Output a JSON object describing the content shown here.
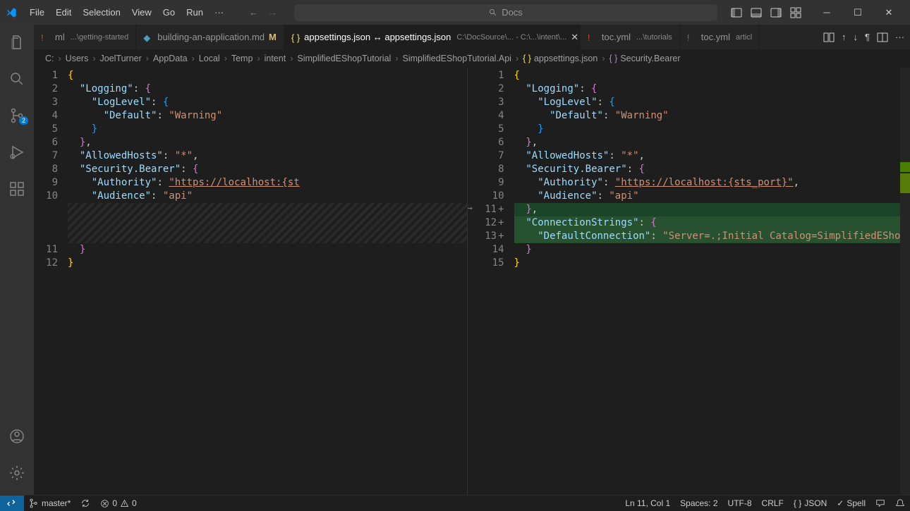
{
  "menu": {
    "items": [
      "File",
      "Edit",
      "Selection",
      "View",
      "Go",
      "Run",
      "···"
    ]
  },
  "search": {
    "placeholder": "Docs"
  },
  "activitybar": {
    "scm_badge": "2"
  },
  "tabs": [
    {
      "icon": "yaml",
      "label": "ml",
      "desc": "...\\getting-started",
      "active": false
    },
    {
      "icon": "md",
      "label": "building-an-application.md",
      "mod": "M",
      "active": false
    },
    {
      "icon": "json",
      "label": "appsettings.json ↔ appsettings.json",
      "desc": "C:\\DocSource\\... - C:\\...\\intent\\...",
      "active": true,
      "close": true
    },
    {
      "icon": "yaml",
      "label": "toc.yml",
      "desc": "...\\tutorials",
      "active": false
    },
    {
      "icon": "yaml",
      "label": "toc.yml",
      "desc": "articl",
      "active": false
    }
  ],
  "breadcrumbs": [
    "C:",
    "Users",
    "JoelTurner",
    "AppData",
    "Local",
    "Temp",
    "intent",
    "SimplifiedEShopTutorial",
    "SimplifiedEShopTutorial.Api",
    "appsettings.json",
    "Security.Bearer"
  ],
  "left_editor": {
    "line_numbers": [
      "1",
      "2",
      "3",
      "4",
      "5",
      "6",
      "7",
      "8",
      "9",
      "10",
      "",
      "",
      "",
      "11",
      "12"
    ],
    "lines": [
      [
        {
          "c": "brace",
          "t": "{"
        }
      ],
      [
        {
          "i": 2
        },
        {
          "c": "key",
          "t": "\"Logging\""
        },
        {
          "c": "punc",
          "t": ": "
        },
        {
          "c": "brace-p",
          "t": "{"
        }
      ],
      [
        {
          "i": 4
        },
        {
          "c": "key",
          "t": "\"LogLevel\""
        },
        {
          "c": "punc",
          "t": ": "
        },
        {
          "c": "brace-b",
          "t": "{"
        }
      ],
      [
        {
          "i": 6
        },
        {
          "c": "key",
          "t": "\"Default\""
        },
        {
          "c": "punc",
          "t": ": "
        },
        {
          "c": "str",
          "t": "\"Warning\""
        }
      ],
      [
        {
          "i": 4
        },
        {
          "c": "brace-b",
          "t": "}"
        }
      ],
      [
        {
          "i": 2
        },
        {
          "c": "brace-p",
          "t": "}"
        },
        {
          "c": "punc",
          "t": ","
        }
      ],
      [
        {
          "i": 2
        },
        {
          "c": "key",
          "t": "\"AllowedHosts\""
        },
        {
          "c": "punc",
          "t": ": "
        },
        {
          "c": "str",
          "t": "\"*\""
        },
        {
          "c": "punc",
          "t": ","
        }
      ],
      [
        {
          "i": 2
        },
        {
          "c": "key",
          "t": "\"Security.Bearer\""
        },
        {
          "c": "punc",
          "t": ": "
        },
        {
          "c": "brace-p",
          "t": "{"
        }
      ],
      [
        {
          "i": 4
        },
        {
          "c": "key",
          "t": "\"Authority\""
        },
        {
          "c": "punc",
          "t": ": "
        },
        {
          "c": "link",
          "t": "\"https://localhost:{st"
        }
      ],
      [
        {
          "i": 4
        },
        {
          "c": "key",
          "t": "\"Audience\""
        },
        {
          "c": "punc",
          "t": ": "
        },
        {
          "c": "str",
          "t": "\"api\""
        }
      ]
    ],
    "end_lines": [
      [
        {
          "i": 2
        },
        {
          "c": "brace-p",
          "t": "}"
        }
      ],
      [
        {
          "c": "brace",
          "t": "}"
        }
      ]
    ]
  },
  "right_editor": {
    "line_numbers": [
      "1",
      "2",
      "3",
      "4",
      "5",
      "6",
      "7",
      "8",
      "9",
      "10",
      "11",
      "12",
      "13",
      "14",
      "15"
    ],
    "plus_rows": [
      11,
      12,
      13
    ],
    "lines": [
      [
        {
          "c": "brace",
          "t": "{"
        }
      ],
      [
        {
          "i": 2
        },
        {
          "c": "key",
          "t": "\"Logging\""
        },
        {
          "c": "punc",
          "t": ": "
        },
        {
          "c": "brace-p",
          "t": "{"
        }
      ],
      [
        {
          "i": 4
        },
        {
          "c": "key",
          "t": "\"LogLevel\""
        },
        {
          "c": "punc",
          "t": ": "
        },
        {
          "c": "brace-b",
          "t": "{"
        }
      ],
      [
        {
          "i": 6
        },
        {
          "c": "key",
          "t": "\"Default\""
        },
        {
          "c": "punc",
          "t": ": "
        },
        {
          "c": "str",
          "t": "\"Warning\""
        }
      ],
      [
        {
          "i": 4
        },
        {
          "c": "brace-b",
          "t": "}"
        }
      ],
      [
        {
          "i": 2
        },
        {
          "c": "brace-p",
          "t": "}"
        },
        {
          "c": "punc",
          "t": ","
        }
      ],
      [
        {
          "i": 2
        },
        {
          "c": "key",
          "t": "\"AllowedHosts\""
        },
        {
          "c": "punc",
          "t": ": "
        },
        {
          "c": "str",
          "t": "\"*\""
        },
        {
          "c": "punc",
          "t": ","
        }
      ],
      [
        {
          "i": 2
        },
        {
          "c": "key",
          "t": "\"Security.Bearer\""
        },
        {
          "c": "punc",
          "t": ": "
        },
        {
          "c": "brace-p",
          "t": "{"
        }
      ],
      [
        {
          "i": 4
        },
        {
          "c": "key",
          "t": "\"Authority\""
        },
        {
          "c": "punc",
          "t": ": "
        },
        {
          "c": "link",
          "t": "\"https://localhost:{sts_port}\""
        },
        {
          "c": "punc",
          "t": ","
        }
      ],
      [
        {
          "i": 4
        },
        {
          "c": "key",
          "t": "\"Audience\""
        },
        {
          "c": "punc",
          "t": ": "
        },
        {
          "c": "str",
          "t": "\"api\""
        }
      ],
      [
        {
          "i": 2
        },
        {
          "c": "brace-p",
          "t": "}"
        },
        {
          "c": "punc",
          "t": ","
        }
      ],
      [
        {
          "i": 2
        },
        {
          "c": "key",
          "t": "\"ConnectionStrings\""
        },
        {
          "c": "punc",
          "t": ": "
        },
        {
          "c": "brace-p",
          "t": "{"
        }
      ],
      [
        {
          "i": 4
        },
        {
          "c": "key",
          "t": "\"DefaultConnection\""
        },
        {
          "c": "punc",
          "t": ": "
        },
        {
          "c": "str",
          "t": "\"Server=.;Initial Catalog=SimplifiedEShopTutorial;Integrated Security=true;Mult"
        }
      ],
      [
        {
          "i": 2
        },
        {
          "c": "brace-p",
          "t": "}"
        }
      ],
      [
        {
          "c": "brace",
          "t": "}"
        }
      ]
    ]
  },
  "status": {
    "branch": "master*",
    "errors": "0",
    "warnings": "0",
    "cursor": "Ln 11, Col 1",
    "spaces": "Spaces: 2",
    "encoding": "UTF-8",
    "eol": "CRLF",
    "lang": "JSON",
    "spell": "Spell"
  }
}
